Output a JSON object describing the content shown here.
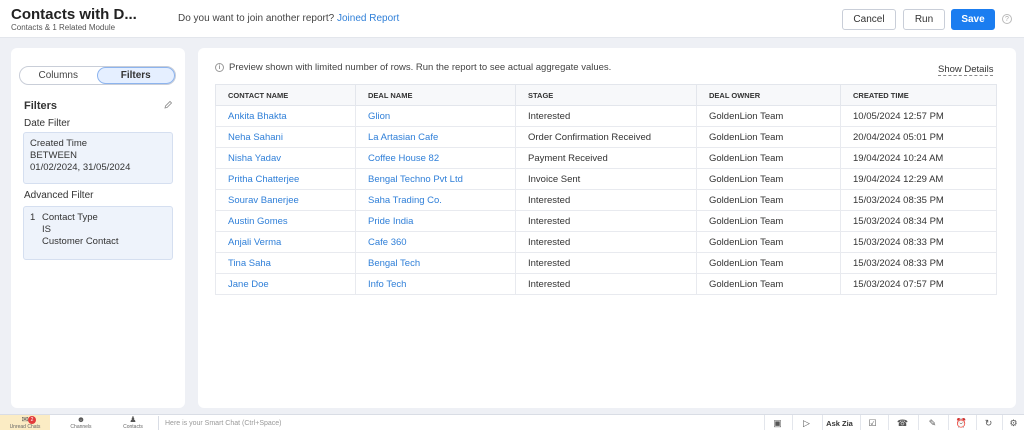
{
  "header": {
    "title": "Contacts with D...",
    "subtitle": "Contacts & 1 Related Module",
    "join_prompt": "Do you want to join another report?",
    "join_link": "Joined Report",
    "cancel_label": "Cancel",
    "run_label": "Run",
    "save_label": "Save",
    "help_icon": "?"
  },
  "sidebar": {
    "tabs": [
      "Columns",
      "Filters"
    ],
    "active_tab": "Filters",
    "filters_heading": "Filters",
    "date_filter_heading": "Date Filter",
    "date_filter": {
      "field": "Created Time",
      "operator": "BETWEEN",
      "value": "01/02/2024, 31/05/2024"
    },
    "advanced_filter_heading": "Advanced Filter",
    "advanced_filter": {
      "index": "1",
      "field": "Contact Type",
      "operator": "IS",
      "value": "Customer Contact"
    }
  },
  "main": {
    "info_icon": "i",
    "preview_text": "Preview shown with limited number of rows. Run the report to see actual aggregate values.",
    "show_details": "Show Details",
    "columns": [
      "CONTACT NAME",
      "DEAL NAME",
      "STAGE",
      "DEAL OWNER",
      "CREATED TIME"
    ],
    "rows": [
      [
        "Ankita Bhakta",
        "Glion",
        "Interested",
        "GoldenLion Team",
        "10/05/2024 12:57 PM"
      ],
      [
        "Neha Sahani",
        "La Artasian Cafe",
        "Order Confirmation Received",
        "GoldenLion Team",
        "20/04/2024 05:01 PM"
      ],
      [
        "Nisha Yadav",
        "Coffee House 82",
        "Payment Received",
        "GoldenLion Team",
        "19/04/2024 10:24 AM"
      ],
      [
        "Pritha Chatterjee",
        "Bengal Techno Pvt Ltd",
        "Invoice Sent",
        "GoldenLion Team",
        "19/04/2024 12:29 AM"
      ],
      [
        "Sourav Banerjee",
        "Saha Trading Co.",
        "Interested",
        "GoldenLion Team",
        "15/03/2024 08:35 PM"
      ],
      [
        "Austin Gomes",
        "Pride India",
        "Interested",
        "GoldenLion Team",
        "15/03/2024 08:34 PM"
      ],
      [
        "Anjali Verma",
        "Cafe 360",
        "Interested",
        "GoldenLion Team",
        "15/03/2024 08:33 PM"
      ],
      [
        "Tina Saha",
        "Bengal Tech",
        "Interested",
        "GoldenLion Team",
        "15/03/2024 08:33 PM"
      ],
      [
        "Jane Doe",
        "Info Tech",
        "Interested",
        "GoldenLion Team",
        "15/03/2024 07:57 PM"
      ]
    ]
  },
  "footer": {
    "tabs": [
      {
        "label": "Unread Chats",
        "icon": "chat-icon",
        "badge": "2"
      },
      {
        "label": "Channels",
        "icon": "channels-icon"
      },
      {
        "label": "Contacts",
        "icon": "contacts-icon"
      }
    ],
    "smart_chat_placeholder": "Here is your Smart Chat (Ctrl+Space)",
    "ask_zia": "Ask Zia"
  },
  "colors": {
    "accent": "#1b7df0",
    "link": "#2f7fd8",
    "background": "#eef0f5"
  }
}
